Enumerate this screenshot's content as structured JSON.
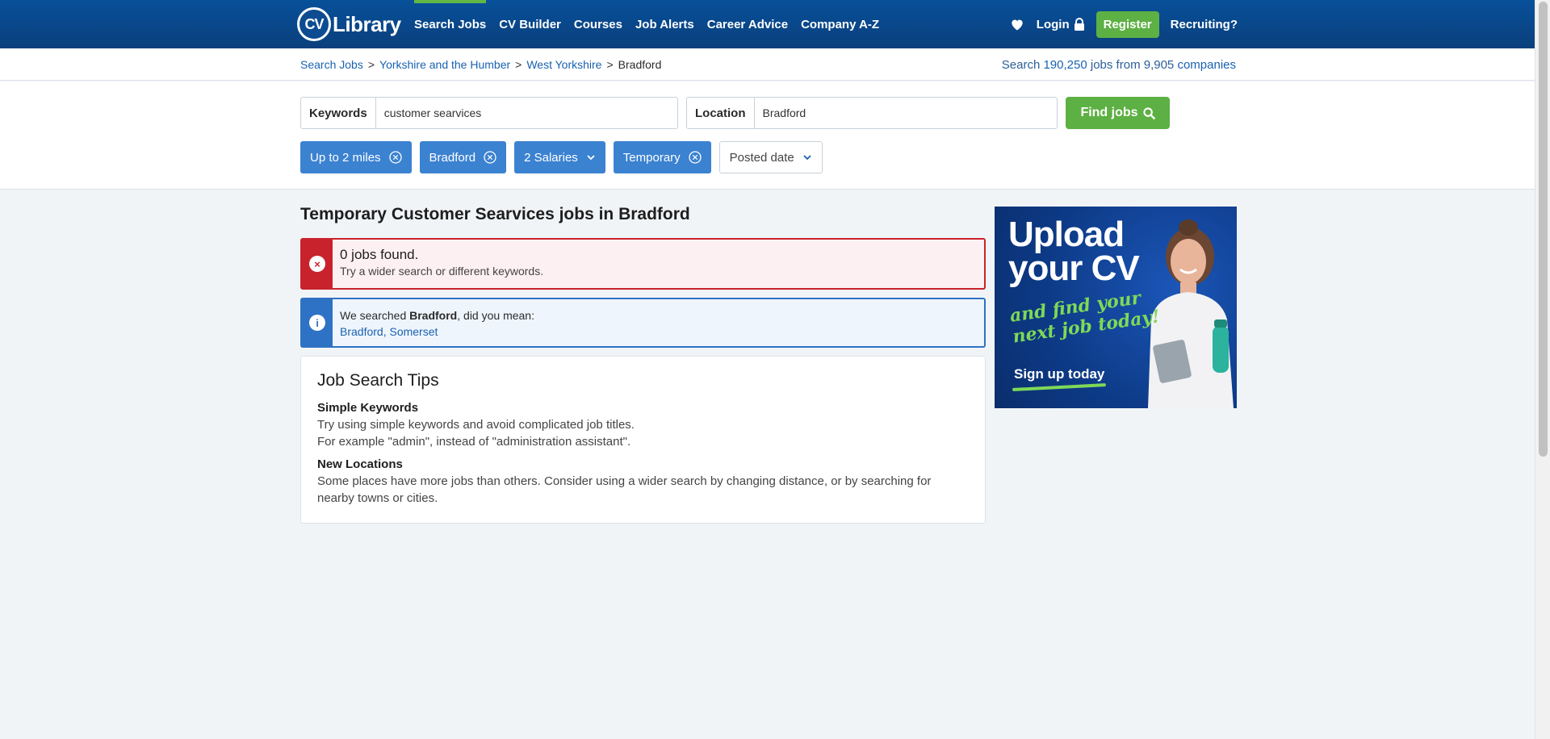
{
  "header": {
    "logo_cv": "CV",
    "logo_text": "Library",
    "nav": [
      "Search Jobs",
      "CV Builder",
      "Courses",
      "Job Alerts",
      "Career Advice",
      "Company A-Z"
    ],
    "login": "Login",
    "register": "Register",
    "recruiting": "Recruiting?"
  },
  "breadcrumb": {
    "items": [
      "Search Jobs",
      "Yorkshire and the Humber",
      "West Yorkshire"
    ],
    "current": "Bradford",
    "separator": ">"
  },
  "stats": {
    "prefix": "Search",
    "jobs_count": "190,250",
    "jobs_label": "jobs from",
    "companies_count": "9,905",
    "companies_label": "companies"
  },
  "search": {
    "keywords_label": "Keywords",
    "keywords_value": "customer searvices",
    "location_label": "Location",
    "location_value": "Bradford",
    "find_label": "Find jobs"
  },
  "filters": {
    "distance": "Up to 2 miles",
    "location": "Bradford",
    "salaries": "2 Salaries",
    "job_type": "Temporary",
    "posted_date": "Posted date"
  },
  "results": {
    "title": "Temporary Customer Searvices jobs in Bradford",
    "error_heading": "0 jobs found.",
    "error_sub": "Try a wider search or different keywords.",
    "info_prefix": "We searched",
    "info_place": "Bradford",
    "info_suffix": ", did you mean:",
    "suggestion": "Bradford, Somerset"
  },
  "tips": {
    "title": "Job Search Tips",
    "items": [
      {
        "heading": "Simple Keywords",
        "lines": [
          "Try using simple keywords and avoid complicated job titles.",
          "For example \"admin\", instead of \"administration assistant\"."
        ]
      },
      {
        "heading": "New Locations",
        "lines": [
          "Some places have more jobs than others. Consider using a wider search by changing distance, or by searching for nearby towns or cities."
        ]
      }
    ]
  },
  "ad": {
    "line1": "Upload",
    "line2": "your CV",
    "tagline1": "and find your",
    "tagline2": "next job today!",
    "cta": "Sign up today"
  },
  "colors": {
    "header": "#0b4a8f",
    "accent_green": "#5db043",
    "chip_blue": "#3b82d1",
    "error_red": "#c8232c",
    "info_blue": "#2d72c4"
  }
}
